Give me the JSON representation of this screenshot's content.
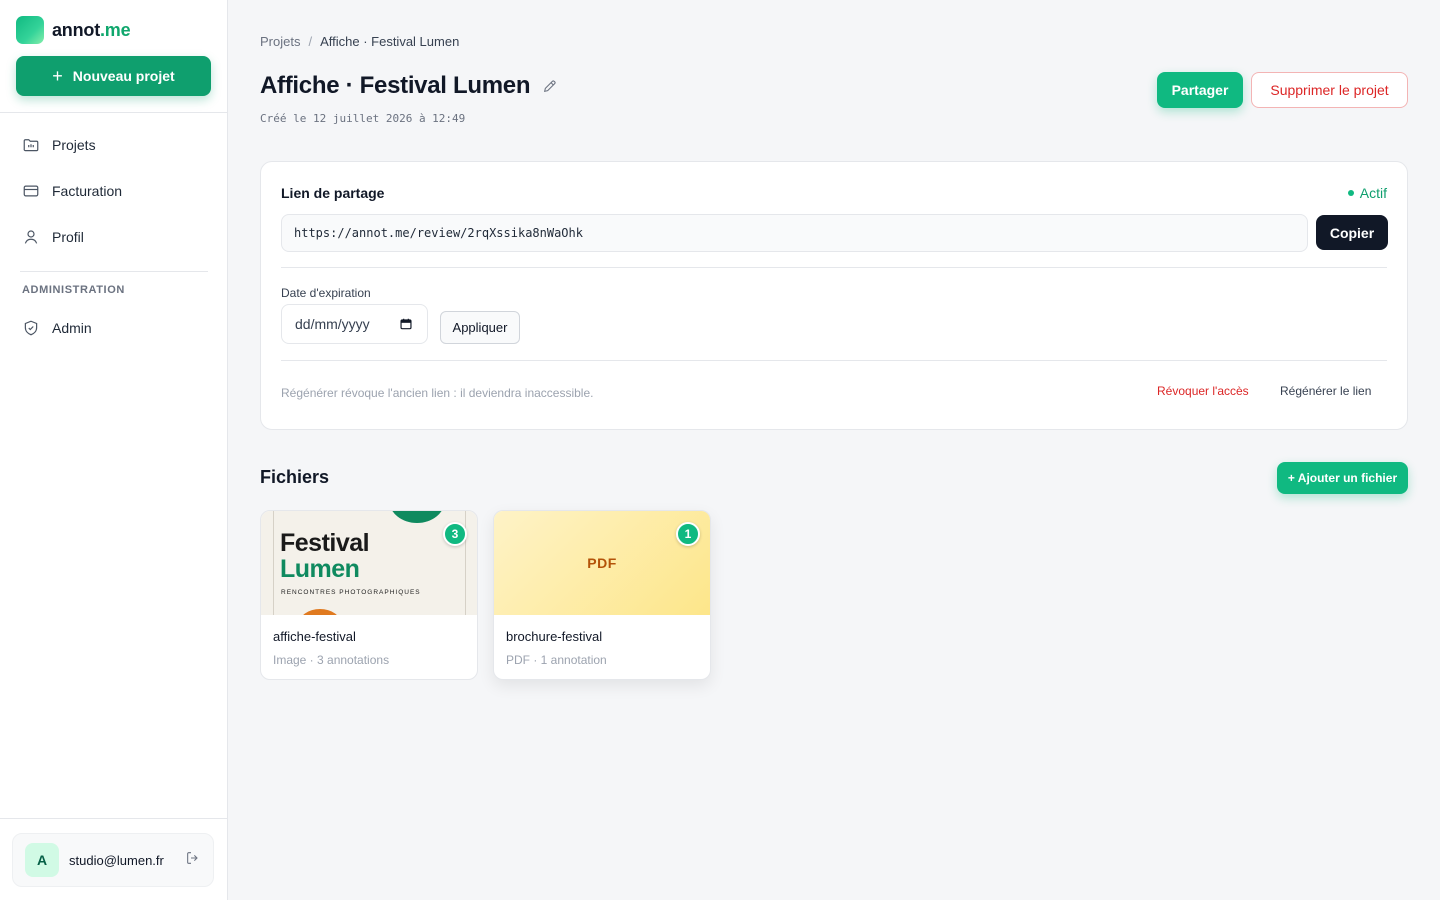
{
  "brand": {
    "name_main": "annot",
    "name_accent": ".me"
  },
  "sidebar": {
    "new_project_label": "Nouveau projet",
    "items": [
      {
        "label": "Projets",
        "icon": "folder-icon"
      },
      {
        "label": "Facturation",
        "icon": "credit-card-icon"
      },
      {
        "label": "Profil",
        "icon": "user-icon"
      }
    ],
    "section_title": "ADMINISTRATION",
    "admin_item": {
      "label": "Admin",
      "icon": "shield-icon"
    },
    "user": {
      "initial": "A",
      "email": "studio@lumen.fr"
    }
  },
  "breadcrumb": {
    "root": "Projets",
    "separator": "/",
    "current": "Affiche · Festival Lumen"
  },
  "page": {
    "title": "Affiche · Festival Lumen",
    "created": "Créé le 12 juillet 2026 à 12:49",
    "share_label": "Partager",
    "delete_label": "Supprimer le projet"
  },
  "share": {
    "title": "Lien de partage",
    "status": "Actif",
    "url": "https://annot.me/review/2rqXssika8nWaOhk",
    "copy_label": "Copier",
    "expiration_label": "Date d'expiration",
    "date_placeholder": "dd/mm/yyyy",
    "apply_label": "Appliquer",
    "note": "Régénérer révoque l'ancien lien : il deviendra inaccessible.",
    "revoke_label": "Révoquer l'accès",
    "regen_label": "Régénérer le lien"
  },
  "files": {
    "title": "Fichiers",
    "add_label": "+ Ajouter un fichier",
    "items": [
      {
        "name": "affiche-festival",
        "meta": "Image · 3 annotations",
        "badge": "3",
        "thumb": {
          "line1": "Festival",
          "line2": "Lumen",
          "sub": "RENCONTRES PHOTOGRAPHIQUES"
        }
      },
      {
        "name": "brochure-festival",
        "meta": "PDF · 1 annotation",
        "badge": "1",
        "thumb": {
          "label": "PDF"
        }
      }
    ]
  },
  "colors": {
    "accent": "#10b981",
    "accent_dark": "#0f9f6e",
    "danger": "#dc2626",
    "dark": "#111827"
  }
}
